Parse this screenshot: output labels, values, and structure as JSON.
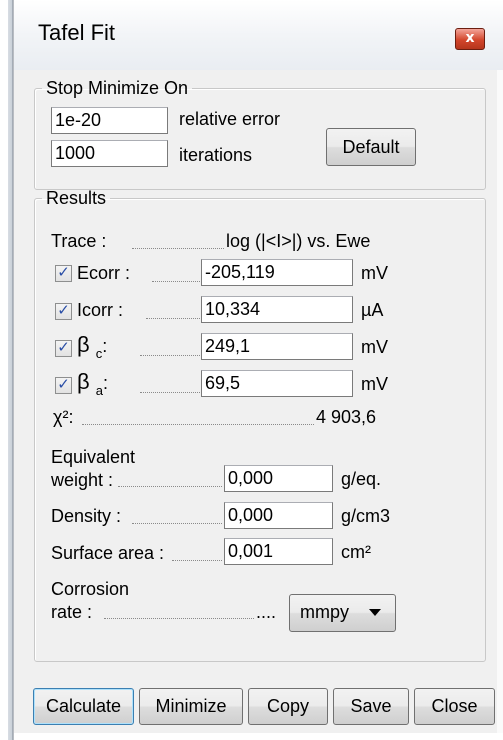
{
  "window": {
    "title": "Tafel Fit",
    "close_glyph": "x"
  },
  "stop_minimize": {
    "legend": "Stop Minimize On",
    "relative_error_value": "1e-20",
    "relative_error_label": "relative error",
    "iterations_value": "1000",
    "iterations_label": "iterations",
    "default_button": "Default"
  },
  "results": {
    "legend": "Results",
    "trace_label": "Trace :",
    "trace_value": "log (|<I>|) vs. Ewe",
    "params": [
      {
        "label": "Ecorr :",
        "value": "-205,119",
        "unit": "mV",
        "checked": true
      },
      {
        "label": "Icorr :",
        "value": "10,334",
        "unit": "µA",
        "checked": true
      },
      {
        "label_main": "β",
        "label_sub": "c",
        "label_suffix": ":",
        "value": "249,1",
        "unit": "mV",
        "checked": true
      },
      {
        "label_main": "β",
        "label_sub": "a",
        "label_suffix": ":",
        "value": "69,5",
        "unit": "mV",
        "checked": true
      }
    ],
    "chi2_label": "χ²:",
    "chi2_value": "4 903,6",
    "equivalent_weight_label_1": "Equivalent",
    "equivalent_weight_label_2": "weight :",
    "equivalent_weight_value": "0,000",
    "equivalent_weight_unit": "g/eq.",
    "density_label": "Density :",
    "density_value": "0,000",
    "density_unit": "g/cm3",
    "surface_area_label": "Surface area :",
    "surface_area_value": "0,001",
    "surface_area_unit": "cm²",
    "corrosion_rate_label_1": "Corrosion",
    "corrosion_rate_label_2": "rate :",
    "corrosion_rate_dots": "....",
    "corrosion_rate_unit_selected": "mmpy"
  },
  "buttons": {
    "calculate": "Calculate",
    "minimize": "Minimize",
    "copy": "Copy",
    "save": "Save",
    "close": "Close"
  },
  "colors": {
    "check_mark": "#2a4ea6",
    "close_button": "#c9462c",
    "focus_border": "#3c7fb1"
  },
  "icons": {
    "check": "checkmark-icon",
    "dropdown": "chevron-down-icon",
    "close": "close-icon"
  }
}
